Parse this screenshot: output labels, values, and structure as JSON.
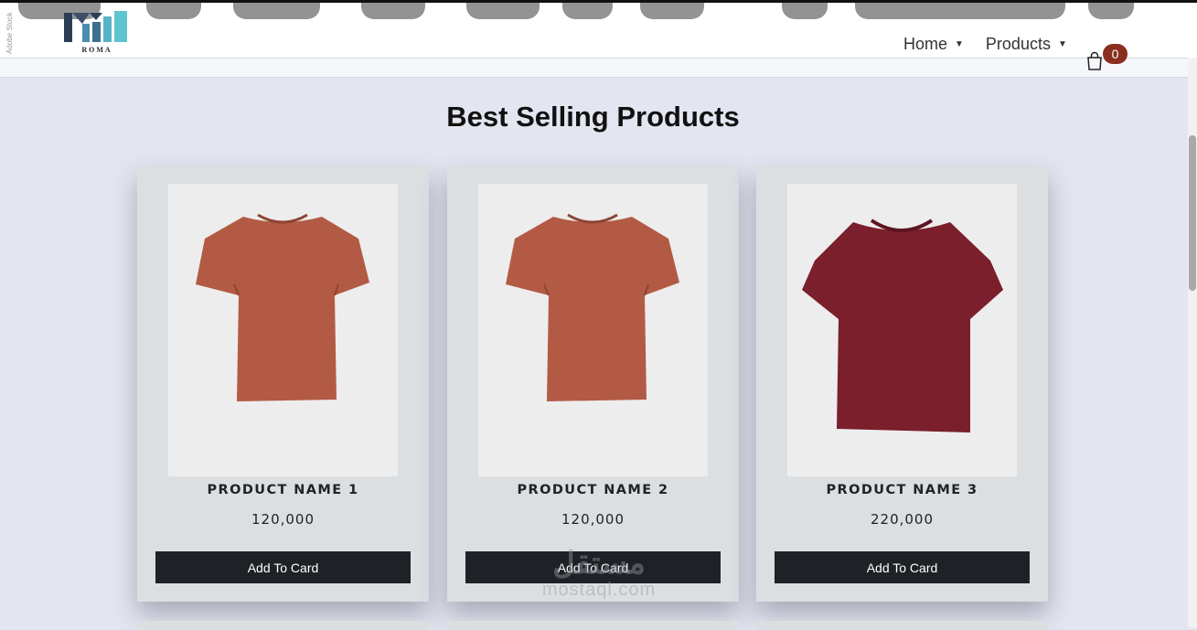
{
  "header": {
    "side_text": "Adobe Stock",
    "logo_text": "ROMA",
    "nav": [
      {
        "label": "Home"
      },
      {
        "label": "Products"
      }
    ],
    "cart_count": "0"
  },
  "main": {
    "title": "Best Selling Products",
    "products": [
      {
        "name": "PRODUCT NAME 1",
        "price": "120,000",
        "button": "Add To Card",
        "shirt_color": "#b35a45"
      },
      {
        "name": "PRODUCT NAME 2",
        "price": "120,000",
        "button": "Add To Card",
        "shirt_color": "#b35a45"
      },
      {
        "name": "PRODUCT NAME 3",
        "price": "220,000",
        "button": "Add To Card",
        "shirt_color": "#7a1f2b"
      }
    ]
  },
  "watermark": {
    "arabic": "مستقل",
    "latin": "mostaql.com"
  },
  "colors": {
    "background": "#e3e5f0",
    "card": "#dcdfe2",
    "button": "#1e2126",
    "badge": "#8b2e1e"
  }
}
